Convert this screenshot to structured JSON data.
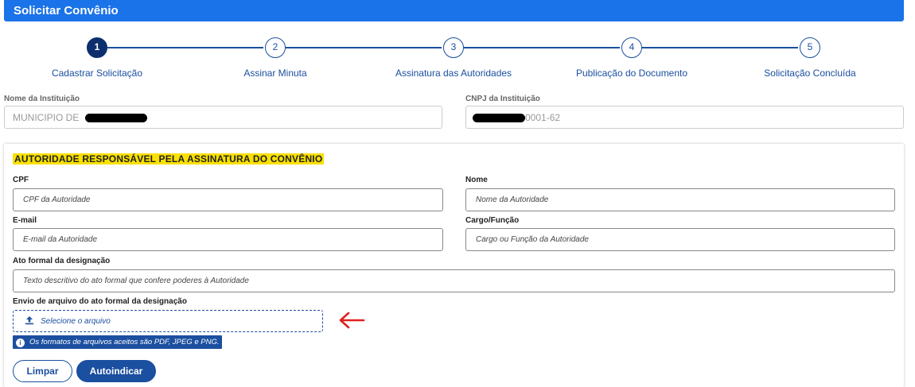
{
  "header": {
    "title": "Solicitar Convênio",
    "color": "#1a73e8"
  },
  "stepper": {
    "steps": [
      {
        "number": "1",
        "label": "Cadastrar Solicitação",
        "active": true
      },
      {
        "number": "2",
        "label": "Assinar Minuta",
        "active": false
      },
      {
        "number": "3",
        "label": "Assinatura das Autoridades",
        "active": false
      },
      {
        "number": "4",
        "label": "Publicação do Documento",
        "active": false
      },
      {
        "number": "5",
        "label": "Solicitação Concluída",
        "active": false
      }
    ]
  },
  "institution": {
    "name_label": "Nome da Instituição",
    "name_value": "MUNICIPIO DE",
    "cnpj_label": "CNPJ da Instituição",
    "cnpj_value": "0001-62"
  },
  "authority": {
    "section_title": "AUTORIDADE RESPONSÁVEL PELA ASSINATURA DO CONVÊNIO",
    "cpf_label": "CPF",
    "cpf_placeholder": "CPF da Autoridade",
    "nome_label": "Nome",
    "nome_placeholder": "Nome da Autoridade",
    "email_label": "E-mail",
    "email_placeholder": "E-mail da Autoridade",
    "cargo_label": "Cargo/Função",
    "cargo_placeholder": "Cargo ou Função da Autoridade",
    "ato_label": "Ato formal da designação",
    "ato_placeholder": "Texto descritivo do ato formal que confere poderes à Autoridade",
    "upload_label": "Envio de arquivo do ato formal da designação",
    "upload_button": "Selecione o arquivo",
    "formats_info": "Os formatos de arquivos aceitos são PDF, JPEG e PNG.",
    "clear_button": "Limpar",
    "self_assign_button": "Autoindicar"
  },
  "colors": {
    "primary": "#1b4fa0",
    "highlight": "#f9e000",
    "annotation_arrow": "#e02020"
  },
  "icons": {
    "upload": "upload-icon",
    "info": "info-icon",
    "annotation": "arrow-left-icon"
  }
}
